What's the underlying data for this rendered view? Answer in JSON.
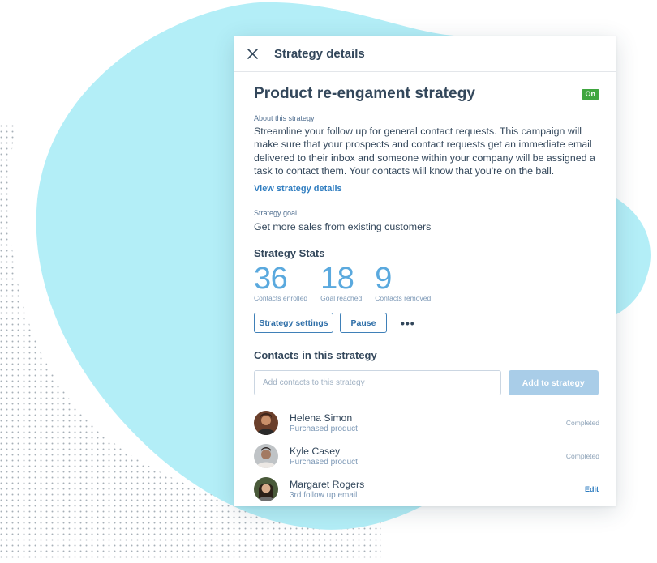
{
  "colors": {
    "blob": "#b2eef6",
    "accent": "#5aa9de",
    "link": "#2f7dc0",
    "status_on": "#3fa63f",
    "text": "#33475b"
  },
  "header": {
    "close_icon": "close-icon",
    "title": "Strategy details"
  },
  "strategy": {
    "title": "Product re-engament strategy",
    "status": "On",
    "about_label": "About this strategy",
    "about_text": "Streamline your follow up for general contact requests. This campaign will make sure that your prospects and contact requests get an immediate email delivered to their inbox and someone within your company will be assigned a task to contact them. Your contacts will know that you're on the ball.",
    "view_details_link": "View strategy details",
    "goal_label": "Strategy goal",
    "goal_text": "Get more sales from existing customers"
  },
  "stats": {
    "heading": "Strategy Stats",
    "items": [
      {
        "value": "36",
        "label": "Contacts enrolled"
      },
      {
        "value": "18",
        "label": "Goal reached"
      },
      {
        "value": "9",
        "label": "Contacts removed"
      }
    ]
  },
  "actions": {
    "settings_label": "Strategy settings",
    "pause_label": "Pause",
    "more_label": "•••",
    "more_icon": "more-icon"
  },
  "contacts": {
    "heading": "Contacts in this strategy",
    "input_placeholder": "Add contacts to this strategy",
    "add_button_label": "Add to strategy",
    "items": [
      {
        "name": "Helena Simon",
        "sub": "Purchased product",
        "status": "Completed"
      },
      {
        "name": "Kyle Casey",
        "sub": "Purchased product",
        "status": "Completed"
      },
      {
        "name": "Margaret Rogers",
        "sub": "3rd follow up email",
        "action": "Edit"
      }
    ]
  }
}
